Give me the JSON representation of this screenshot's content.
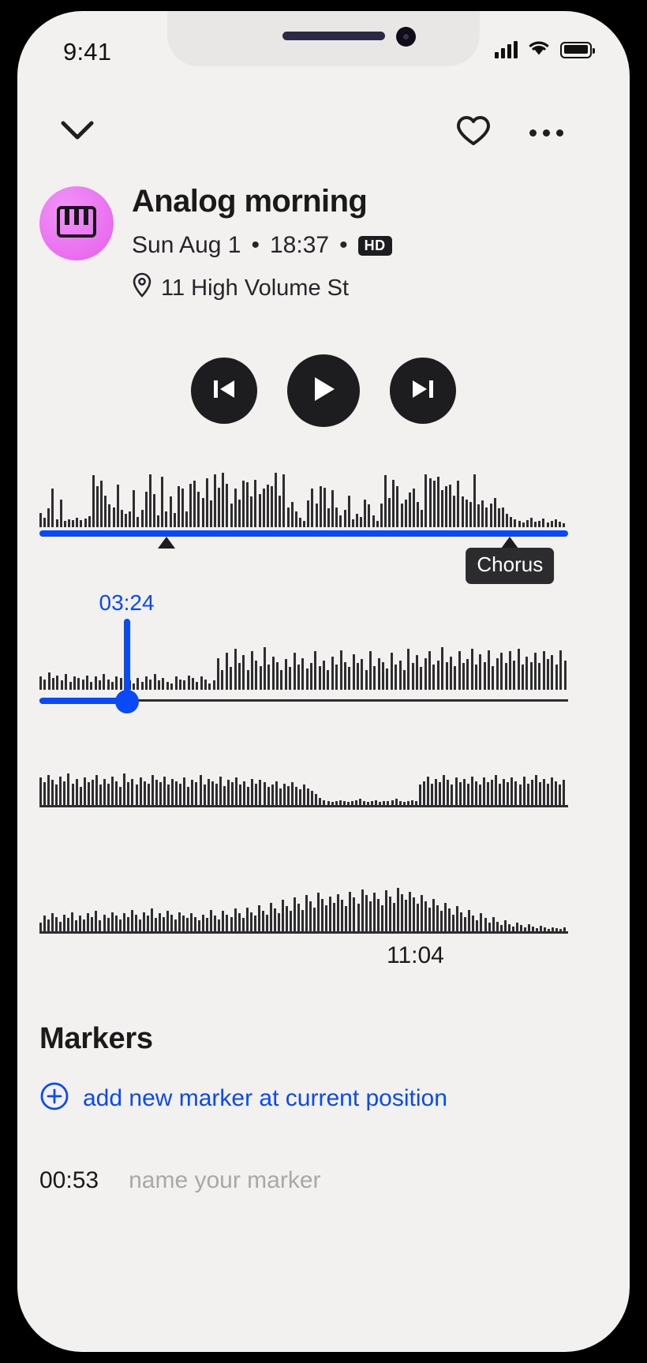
{
  "status_bar": {
    "time": "9:41",
    "signal_icon": "cellular-signal-icon",
    "wifi_icon": "wifi-icon",
    "battery_icon": "battery-full-icon"
  },
  "top_nav": {
    "collapse_icon": "chevron-down-icon",
    "favorite_icon": "heart-outline-icon",
    "more_icon": "ellipsis-icon"
  },
  "recording": {
    "artwork_icon": "piano-keys-icon",
    "artwork_color": "#ea6ff0",
    "title": "Analog morning",
    "date": "Sun Aug 1",
    "time": "18:37",
    "separator": "•",
    "quality_badge": "HD",
    "location_icon": "location-pin-icon",
    "location": "11 High Volume St"
  },
  "transport": {
    "previous_label": "previous-track",
    "play_label": "play",
    "next_label": "next-track",
    "button_color": "#1d1d1f",
    "state": "paused"
  },
  "player": {
    "accent_color": "#0a49f6",
    "current_time": "03:24",
    "total_time": "11:04",
    "progress_percent": 100,
    "playhead_percent": 16.5,
    "markers": [
      {
        "label": "",
        "position_percent": 24
      },
      {
        "label": "Chorus",
        "position_percent": 89
      }
    ]
  },
  "markers_section": {
    "heading": "Markers",
    "add_icon": "plus-circle-icon",
    "add_label": "add new marker at current position",
    "entry_time": "00:53",
    "entry_placeholder": "name your marker",
    "entry_value": ""
  },
  "waveforms": {
    "row1": [
      22,
      14,
      28,
      58,
      12,
      42,
      10,
      12,
      11,
      14,
      11,
      13,
      17,
      78,
      62,
      70,
      48,
      34,
      30,
      64,
      26,
      20,
      24,
      56,
      16,
      26,
      54,
      80,
      50,
      18,
      76,
      24,
      46,
      22,
      62,
      58,
      24,
      66,
      70,
      54,
      44,
      74,
      40,
      80,
      60,
      82,
      66,
      36,
      58,
      42,
      70,
      68,
      46,
      72,
      50,
      58,
      64,
      62,
      82,
      48,
      80,
      30,
      38,
      24,
      14,
      10,
      40,
      58,
      36,
      62,
      60,
      28,
      56,
      30,
      18,
      26,
      48,
      12,
      20,
      16,
      42,
      34,
      18,
      10,
      36,
      78,
      44,
      72,
      62,
      36,
      42,
      52,
      58,
      38,
      26,
      80,
      74,
      70,
      76,
      56,
      62,
      64,
      48,
      70,
      46,
      42,
      38,
      80,
      34,
      40,
      30,
      36,
      44,
      28,
      30,
      20,
      16,
      12,
      9,
      7,
      11,
      14,
      8,
      10,
      13,
      7,
      9,
      12,
      8,
      6
    ],
    "row2": [
      20,
      16,
      26,
      18,
      22,
      14,
      24,
      12,
      20,
      18,
      16,
      22,
      12,
      20,
      14,
      24,
      16,
      12,
      20,
      18,
      22,
      14,
      10,
      18,
      12,
      20,
      16,
      24,
      14,
      18,
      12,
      10,
      20,
      16,
      14,
      22,
      18,
      12,
      20,
      16,
      10,
      14,
      48,
      30,
      56,
      34,
      62,
      40,
      52,
      30,
      58,
      44,
      36,
      64,
      38,
      50,
      42,
      30,
      46,
      34,
      56,
      38,
      48,
      32,
      40,
      58,
      36,
      44,
      30,
      50,
      38,
      60,
      42,
      34,
      54,
      40,
      46,
      30,
      58,
      36,
      48,
      42,
      32,
      56,
      38,
      44,
      30,
      62,
      40,
      52,
      34,
      48,
      58,
      38,
      44,
      64,
      42,
      50,
      36,
      58,
      40,
      46,
      62,
      38,
      54,
      42,
      60,
      36,
      48,
      56,
      40,
      58,
      44,
      62,
      38,
      50,
      42,
      56,
      40,
      58,
      46,
      52,
      38,
      60,
      44
    ],
    "row3": [
      46,
      38,
      50,
      42,
      34,
      48,
      40,
      52,
      36,
      44,
      30,
      46,
      38,
      42,
      50,
      34,
      44,
      36,
      48,
      40,
      30,
      52,
      38,
      44,
      34,
      46,
      40,
      36,
      50,
      42,
      38,
      48,
      34,
      44,
      40,
      36,
      46,
      30,
      42,
      38,
      50,
      34,
      44,
      40,
      36,
      48,
      32,
      42,
      38,
      46,
      34,
      40,
      30,
      44,
      36,
      42,
      38,
      30,
      34,
      40,
      28,
      36,
      32,
      38,
      30,
      26,
      34,
      28,
      24,
      18,
      12,
      8,
      6,
      5,
      6,
      8,
      7,
      5,
      6,
      8,
      10,
      7,
      5,
      6,
      8,
      5,
      7,
      6,
      8,
      10,
      6,
      5,
      7,
      8,
      6,
      34,
      40,
      48,
      36,
      44,
      38,
      50,
      42,
      34,
      46,
      38,
      44,
      36,
      48,
      40,
      34,
      46,
      38,
      42,
      50,
      36,
      44,
      38,
      46,
      40,
      34,
      48,
      36,
      42,
      50,
      38,
      44,
      36,
      46,
      40,
      34,
      42
    ],
    "row4": [
      14,
      26,
      20,
      30,
      24,
      16,
      28,
      22,
      32,
      18,
      26,
      20,
      30,
      24,
      34,
      18,
      28,
      22,
      32,
      26,
      20,
      30,
      24,
      36,
      28,
      20,
      32,
      26,
      38,
      22,
      30,
      24,
      34,
      28,
      20,
      32,
      26,
      22,
      30,
      24,
      18,
      28,
      22,
      36,
      26,
      20,
      34,
      28,
      24,
      38,
      30,
      22,
      40,
      32,
      26,
      44,
      34,
      28,
      48,
      38,
      30,
      52,
      42,
      34,
      56,
      46,
      36,
      60,
      50,
      40,
      64,
      54,
      44,
      58,
      48,
      62,
      52,
      42,
      66,
      56,
      46,
      70,
      60,
      50,
      64,
      54,
      44,
      68,
      58,
      48,
      72,
      62,
      52,
      66,
      56,
      46,
      60,
      50,
      40,
      54,
      44,
      34,
      48,
      38,
      28,
      42,
      32,
      24,
      36,
      26,
      18,
      30,
      22,
      14,
      24,
      16,
      10,
      18,
      12,
      8,
      14,
      10,
      6,
      12,
      8,
      5,
      9,
      6,
      4,
      7,
      5,
      3,
      6
    ]
  }
}
